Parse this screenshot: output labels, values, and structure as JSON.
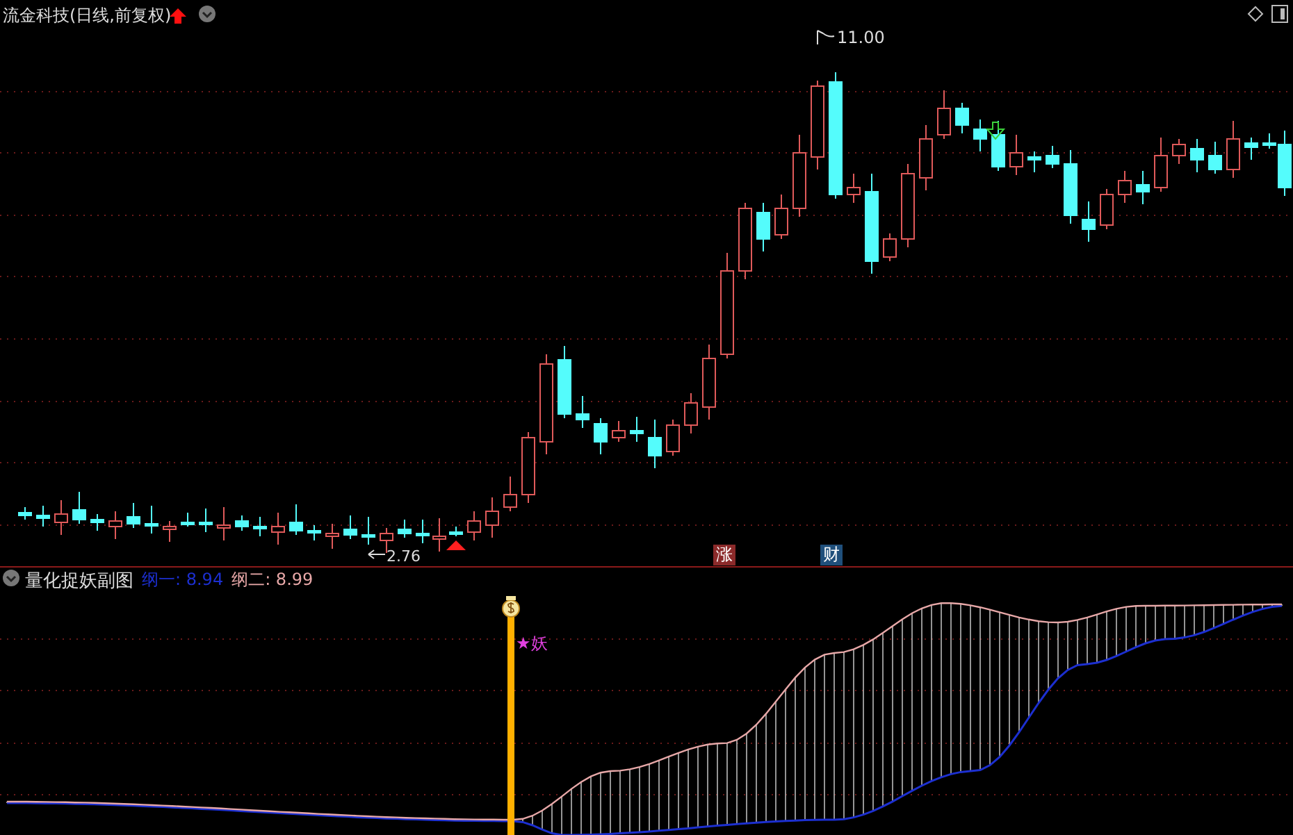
{
  "main_chart": {
    "title": "流金科技(日线,前复权)",
    "low_label": "2.76",
    "high_label": "11.00",
    "markers": [
      {
        "text": "涨",
        "color": "#8b2a2a"
      },
      {
        "text": "财",
        "color": "#1f4f7b"
      }
    ]
  },
  "indicator": {
    "title": "量化捉妖副图",
    "lines": [
      {
        "label": "纲一: 8.94",
        "color": "#1c2fd0"
      },
      {
        "label": "纲二: 8.99",
        "color": "#e8a8a8"
      }
    ],
    "signal": "★妖"
  }
}
